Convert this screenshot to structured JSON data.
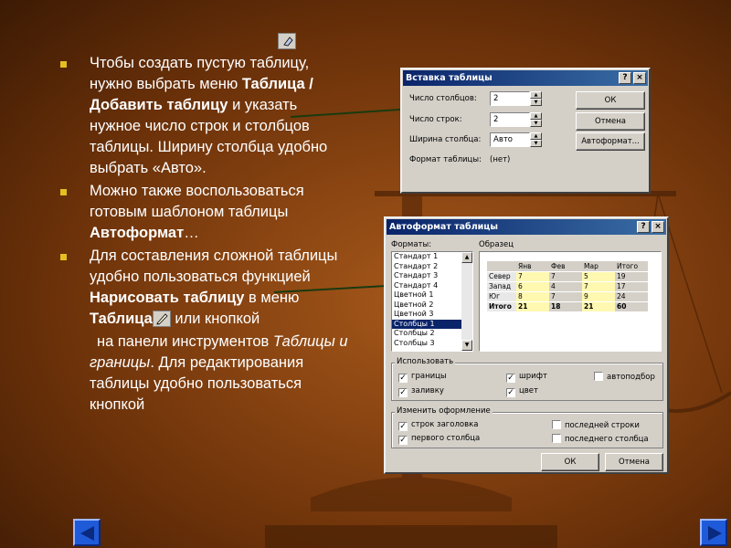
{
  "slide": {
    "bullets": [
      {
        "p1": "Чтобы создать пустую таблицу,  нужно выбрать меню ",
        "b1": "Таблица / Добавить таблицу",
        "p2": " и указать  нужное число строк и столбцов таблицы. Ширину столбца удобно выбрать «Авто»."
      },
      {
        "p1": "Можно также воспользоваться готовым шаблоном таблицы ",
        "b1": "Автоформат",
        "p2": "…"
      },
      {
        "p1": "Для составления сложной таблицы удобно пользоваться функцией ",
        "b1": "Нарисовать таблицу",
        "p2": " в меню ",
        "b2": "Таблица",
        "p3": " или кнопкой"
      }
    ],
    "cont1": " на панели инструментов ",
    "cont_italic": "Таблицы и границы",
    "cont2": ". Для редактирования таблицы удобно пользоваться кнопкой"
  },
  "insert_dialog": {
    "title": "Вставка таблицы",
    "help_label": "?",
    "close_label": "×",
    "cols_label": "Число столбцов:",
    "cols_value": "2",
    "rows_label": "Число строк:",
    "rows_value": "2",
    "width_label": "Ширина столбца:",
    "width_value": "Авто",
    "format_label": "Формат таблицы:",
    "format_value": "(нет)",
    "ok": "ОК",
    "cancel": "Отмена",
    "autoformat": "Автоформат..."
  },
  "autoformat_dialog": {
    "title": "Автоформат таблицы",
    "help_label": "?",
    "close_label": "×",
    "formats_label": "Форматы:",
    "formats": [
      "Стандарт 1",
      "Стандарт 2",
      "Стандарт 3",
      "Стандарт 4",
      "Цветной 1",
      "Цветной 2",
      "Цветной 3",
      "Столбцы 1",
      "Столбцы 2",
      "Столбцы 3"
    ],
    "selected_format": "Столбцы 1",
    "sample_label": "Образец",
    "preview_header": [
      "",
      "Янв",
      "Фев",
      "Мар",
      "Итого"
    ],
    "preview_rows": [
      [
        "Север",
        "7",
        "7",
        "5",
        "19"
      ],
      [
        "Запад",
        "6",
        "4",
        "7",
        "17"
      ],
      [
        "Юг",
        "8",
        "7",
        "9",
        "24"
      ],
      [
        "Итого",
        "21",
        "18",
        "21",
        "60"
      ]
    ],
    "use_label": "Использовать",
    "use_opts": [
      {
        "label": "границы",
        "checked": true
      },
      {
        "label": "шрифт",
        "checked": true
      },
      {
        "label": "автоподбор",
        "checked": false
      },
      {
        "label": "заливку",
        "checked": true
      },
      {
        "label": "цвет",
        "checked": true
      }
    ],
    "modify_label": "Изменить оформление",
    "modify_opts": [
      {
        "label": "строк заголовка",
        "checked": true
      },
      {
        "label": "последней строки",
        "checked": false
      },
      {
        "label": "первого столбца",
        "checked": true
      },
      {
        "label": "последнего столбца",
        "checked": false
      }
    ],
    "ok": "ОК",
    "cancel": "Отмена"
  },
  "nav": {
    "prev_icon": "triangle-left-icon",
    "next_icon": "triangle-right-icon"
  },
  "colors": {
    "accent_arrow": "#1a3a10",
    "bullet_mark": "#e4c020",
    "nav_button": "#1f5bd8",
    "titlebar": "#0a246a"
  }
}
